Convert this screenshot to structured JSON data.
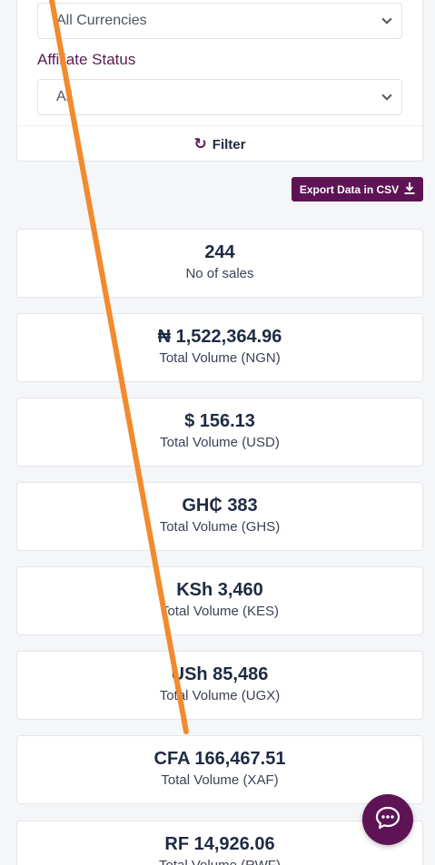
{
  "filters": {
    "currency_value": "All Currencies",
    "affiliate_status_label": "Affiliate Status",
    "affiliate_status_value": "All",
    "filter_button_label": "Filter"
  },
  "export": {
    "label": "Export Data in CSV"
  },
  "stats": [
    {
      "value": "244",
      "label": "No of sales"
    },
    {
      "value": "₦ 1,522,364.96",
      "label": "Total Volume (NGN)"
    },
    {
      "value": "$ 156.13",
      "label": "Total Volume (USD)"
    },
    {
      "value": "GH₵ 383",
      "label": "Total Volume (GHS)"
    },
    {
      "value": "KSh 3,460",
      "label": "Total Volume (KES)"
    },
    {
      "value": "USh 85,486",
      "label": "Total Volume (UGX)"
    },
    {
      "value": "CFA 166,467.51",
      "label": "Total Volume (XAF)"
    },
    {
      "value": "RF 14,926.06",
      "label": "Total Volume (RWF)"
    }
  ],
  "colors": {
    "brand": "#5e1454",
    "annotation_stroke": "#f28a2e"
  },
  "icons": {
    "filter": "refresh-icon",
    "export": "download-icon",
    "chat": "chat-bubble-icon"
  }
}
